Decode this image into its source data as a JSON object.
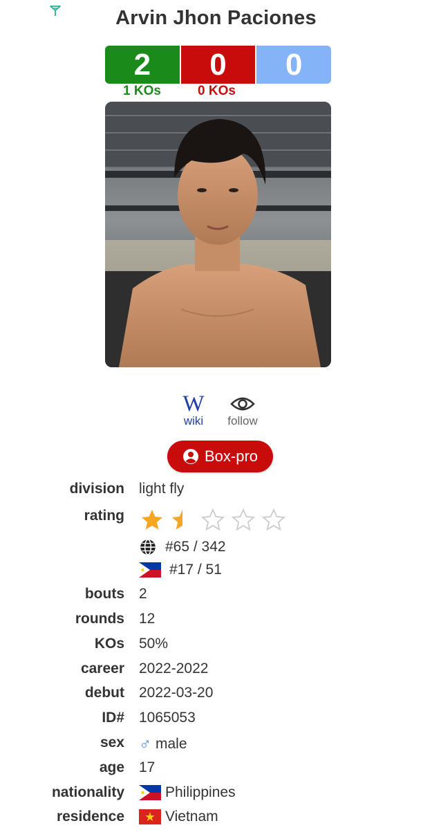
{
  "header": {
    "name": "Arvin Jhon Paciones",
    "logo_icon": "boxrec-logo-icon"
  },
  "record": {
    "wins": "2",
    "losses": "0",
    "draws": "0",
    "win_kos": "1 KOs",
    "loss_kos": "0 KOs",
    "colors": {
      "win": "#1a8a1a",
      "loss": "#c80b0b",
      "draw": "#85b3f7"
    }
  },
  "links": {
    "wiki_label": "wiki",
    "follow_label": "follow",
    "wiki_glyph": "W"
  },
  "button": {
    "label": "Box-pro"
  },
  "labels": {
    "division": "division",
    "rating": "rating",
    "bouts": "bouts",
    "rounds": "rounds",
    "kos": "KOs",
    "career": "career",
    "debut": "debut",
    "id": "ID#",
    "sex": "sex",
    "age": "age",
    "nationality": "nationality",
    "residence": "residence"
  },
  "values": {
    "division": "light fly",
    "rating_stars": 1.5,
    "rating_max": 5,
    "world_rank": "#65 / 342",
    "country_rank": "#17 / 51",
    "bouts": "2",
    "rounds": "12",
    "kos": "50%",
    "career": "2022-2022",
    "debut": "2022-03-20",
    "id": "1065053",
    "sex": "male",
    "age": "17",
    "nationality": "Philippines",
    "residence": "Vietnam"
  }
}
